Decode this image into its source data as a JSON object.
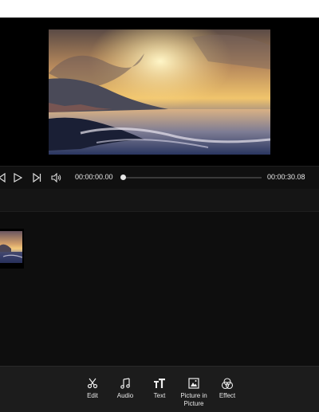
{
  "player": {
    "current_time": "00:00:00.00",
    "total_time": "00:00:30.08",
    "progress": 0.0
  },
  "toolbar": {
    "items": [
      {
        "label": "Edit",
        "icon": "scissors-icon"
      },
      {
        "label": "Audio",
        "icon": "music-note-icon"
      },
      {
        "label": "Text",
        "icon": "text-icon"
      },
      {
        "label": "Picture in Picture",
        "icon": "picture-in-picture-icon"
      },
      {
        "label": "Effect",
        "icon": "effect-icon"
      }
    ]
  },
  "colors": {
    "background": "#0f0f10",
    "toolbar": "#1c1c1c",
    "text": "#e8e8e8"
  }
}
